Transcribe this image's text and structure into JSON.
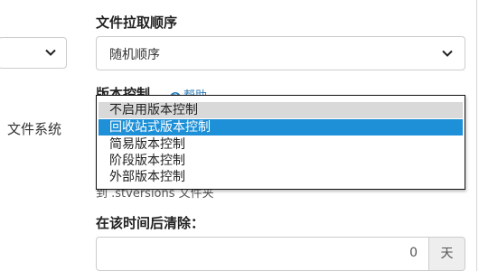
{
  "left": {
    "side_label": "文件系统"
  },
  "file_pull_order": {
    "title": "文件拉取顺序",
    "selected": "随机顺序"
  },
  "version_control": {
    "title": "版本控制",
    "help_label": "帮助",
    "hint_text": "到 .stversions 文件夹",
    "options": [
      {
        "label": "不启用版本控制",
        "state": "selected"
      },
      {
        "label": "回收站式版本控制",
        "state": "highlighted"
      },
      {
        "label": "简易版本控制",
        "state": "normal"
      },
      {
        "label": "阶段版本控制",
        "state": "normal"
      },
      {
        "label": "外部版本控制",
        "state": "normal"
      }
    ]
  },
  "cleanup": {
    "title": "在该时间后清除：",
    "value": "0",
    "unit": "天"
  },
  "colors": {
    "highlight": "#1e90d8",
    "selected_bg": "#d9d9d9",
    "link": "#2b7bb9",
    "border": "#cccccc"
  }
}
